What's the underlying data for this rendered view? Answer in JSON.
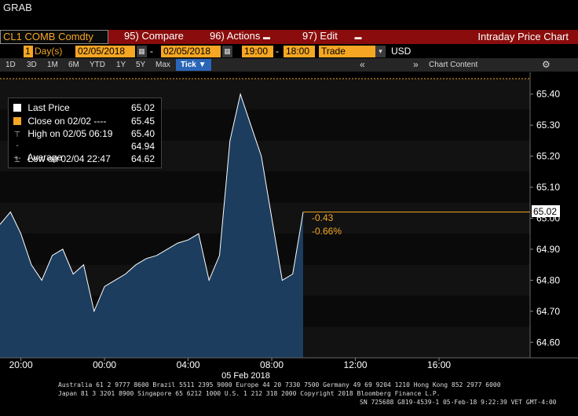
{
  "window": {
    "title": "GRAB"
  },
  "toolbar": {
    "security": "CL1 COMB Comdty",
    "compare": {
      "num": "95)",
      "label": "Compare"
    },
    "actions": {
      "num": "96)",
      "label": "Actions"
    },
    "edit": {
      "num": "97)",
      "label": "Edit"
    },
    "function_title": "Intraday Price Chart"
  },
  "controls": {
    "period_count": "1",
    "period_unit": "Day(s)",
    "start_date": "02/05/2018",
    "end_date": "02/05/2018",
    "start_time": "19:00",
    "end_time": "18:00",
    "event": "Trade",
    "currency": "USD",
    "date_separator": "-",
    "time_separator": "-"
  },
  "ranges": {
    "buttons": [
      "1D",
      "3D",
      "1M",
      "6M",
      "YTD",
      "1Y",
      "5Y",
      "Max"
    ],
    "selected": "Tick ▼",
    "chart_content": "Chart Content"
  },
  "legend": {
    "last_price": {
      "label": "Last Price",
      "value": "65.02",
      "color": "#ffffff"
    },
    "close": {
      "label": "Close on 02/02 ----",
      "value": "65.45",
      "color": "#f5a623"
    },
    "high": {
      "label": "High on 02/05 06:19",
      "value": "65.40"
    },
    "average": {
      "label": "Average",
      "value": "64.94"
    },
    "low": {
      "label": "Low on 02/04 22:47",
      "value": "64.62"
    }
  },
  "annotations": {
    "change": "-0.43",
    "change_pct": "-0.66%",
    "last_tag": "65.02"
  },
  "colors": {
    "accent_orange": "#f5a623",
    "menu_red": "#8a0c0c",
    "area_fill": "#1c3d5e",
    "selected_tab": "#2a66b8"
  },
  "chart_data": {
    "type": "area",
    "x": [
      "19:00",
      "19:30",
      "20:00",
      "20:30",
      "21:00",
      "21:30",
      "22:00",
      "22:30",
      "23:00",
      "23:30",
      "00:00",
      "00:30",
      "01:00",
      "01:30",
      "02:00",
      "02:30",
      "03:00",
      "03:30",
      "04:00",
      "04:30",
      "05:00",
      "05:30",
      "06:00",
      "06:30",
      "07:00",
      "07:30",
      "08:00",
      "08:30",
      "09:00",
      "09:30"
    ],
    "values": [
      64.98,
      65.02,
      64.95,
      64.85,
      64.8,
      64.88,
      64.9,
      64.82,
      64.85,
      64.7,
      64.78,
      64.8,
      64.82,
      64.85,
      64.87,
      64.88,
      64.9,
      64.92,
      64.93,
      64.95,
      64.8,
      64.88,
      65.25,
      65.4,
      65.3,
      65.2,
      65.0,
      64.8,
      64.82,
      65.02
    ],
    "y_ticks": [
      "65.40",
      "65.30",
      "65.20",
      "65.10",
      "65.00",
      "64.90",
      "64.80",
      "64.70",
      "64.60"
    ],
    "ylim": [
      64.55,
      65.45
    ],
    "x_tick_labels": [
      "20:00",
      "00:00",
      "04:00",
      "08:00",
      "12:00",
      "16:00"
    ],
    "x_date_label": "05 Feb 2018",
    "previous_close": 65.45,
    "last_price": 65.02
  },
  "footer": {
    "line1": "Australia 61 2 9777 8600 Brazil 5511 2395 9000 Europe 44 20 7330 7500 Germany 49 69 9204 1210 Hong Kong 852 2977 6000",
    "line2": "Japan 81 3 3201 8900        Singapore 65 6212 1000        U.S. 1 212 318 2000          Copyright 2018 Bloomberg Finance L.P.",
    "line3": "SN 725688 G819-4539-1 05-Feb-18  9:22:39 VET  GMT-4:00"
  }
}
